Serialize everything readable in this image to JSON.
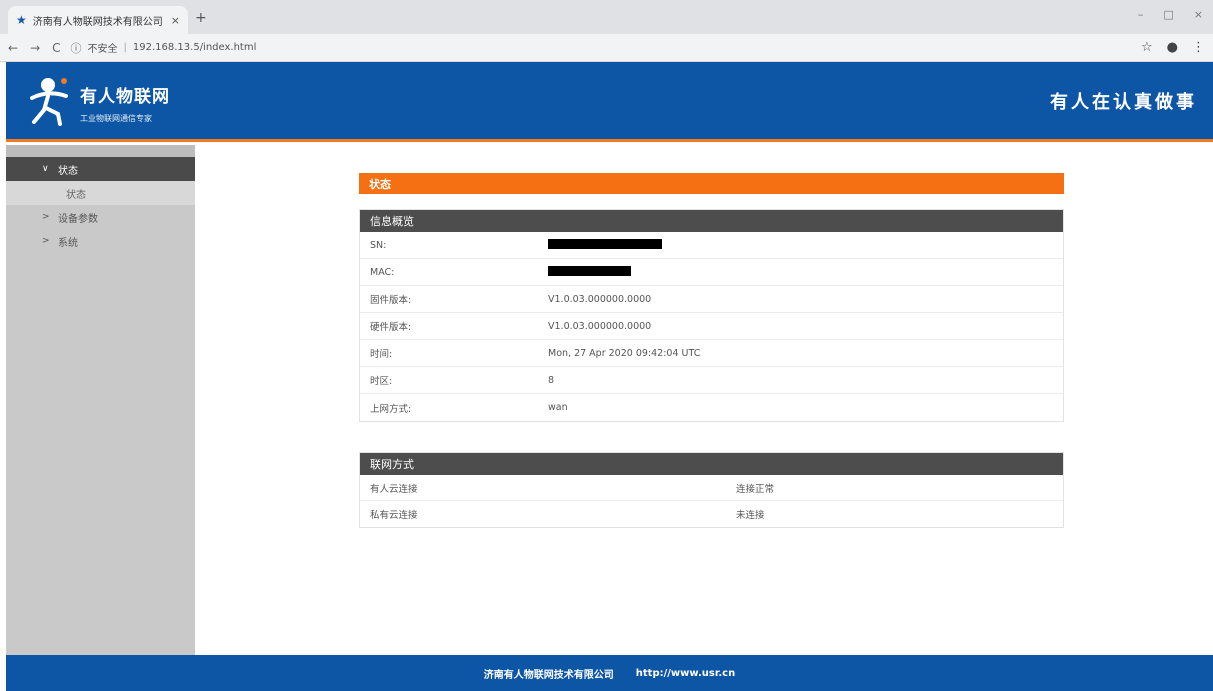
{
  "browser": {
    "tab_title": "济南有人物联网技术有限公司",
    "tab_close": "×",
    "new_tab": "+",
    "win_min": "–",
    "win_max": "□",
    "win_close": "×",
    "back": "←",
    "forward": "→",
    "reload": "C",
    "security_label": "不安全",
    "url": "192.168.13.5/index.html",
    "star": "☆",
    "account": "●",
    "menu": "⋮"
  },
  "header": {
    "brand": "有人物联网",
    "subtitle": "工业物联网通信专家",
    "slogan": "有人在认真做事"
  },
  "sidebar": {
    "items": [
      {
        "label": "状态",
        "chevron": "∨"
      },
      {
        "label": "状态"
      },
      {
        "label": "设备参数",
        "chevron": ">"
      },
      {
        "label": "系统",
        "chevron": ">"
      }
    ]
  },
  "main": {
    "section_title": "状态",
    "info_panel": {
      "title": "信息概览",
      "rows": [
        {
          "label": "SN:",
          "value": ""
        },
        {
          "label": "MAC:",
          "value": ""
        },
        {
          "label": "固件版本:",
          "value": "V1.0.03.000000.0000"
        },
        {
          "label": "硬件版本:",
          "value": "V1.0.03.000000.0000"
        },
        {
          "label": "时间:",
          "value": "Mon, 27 Apr 2020 09:42:04 UTC"
        },
        {
          "label": "时区:",
          "value": "8"
        },
        {
          "label": "上网方式:",
          "value": "wan"
        }
      ]
    },
    "net_panel": {
      "title": "联网方式",
      "rows": [
        {
          "label": "有人云连接",
          "value": "连接正常"
        },
        {
          "label": "私有云连接",
          "value": "未连接"
        }
      ]
    }
  },
  "footer": {
    "company": "济南有人物联网技术有限公司",
    "url": "http://www.usr.cn"
  },
  "colors": {
    "brand_blue": "#0d56a6",
    "accent_orange": "#f47012"
  }
}
